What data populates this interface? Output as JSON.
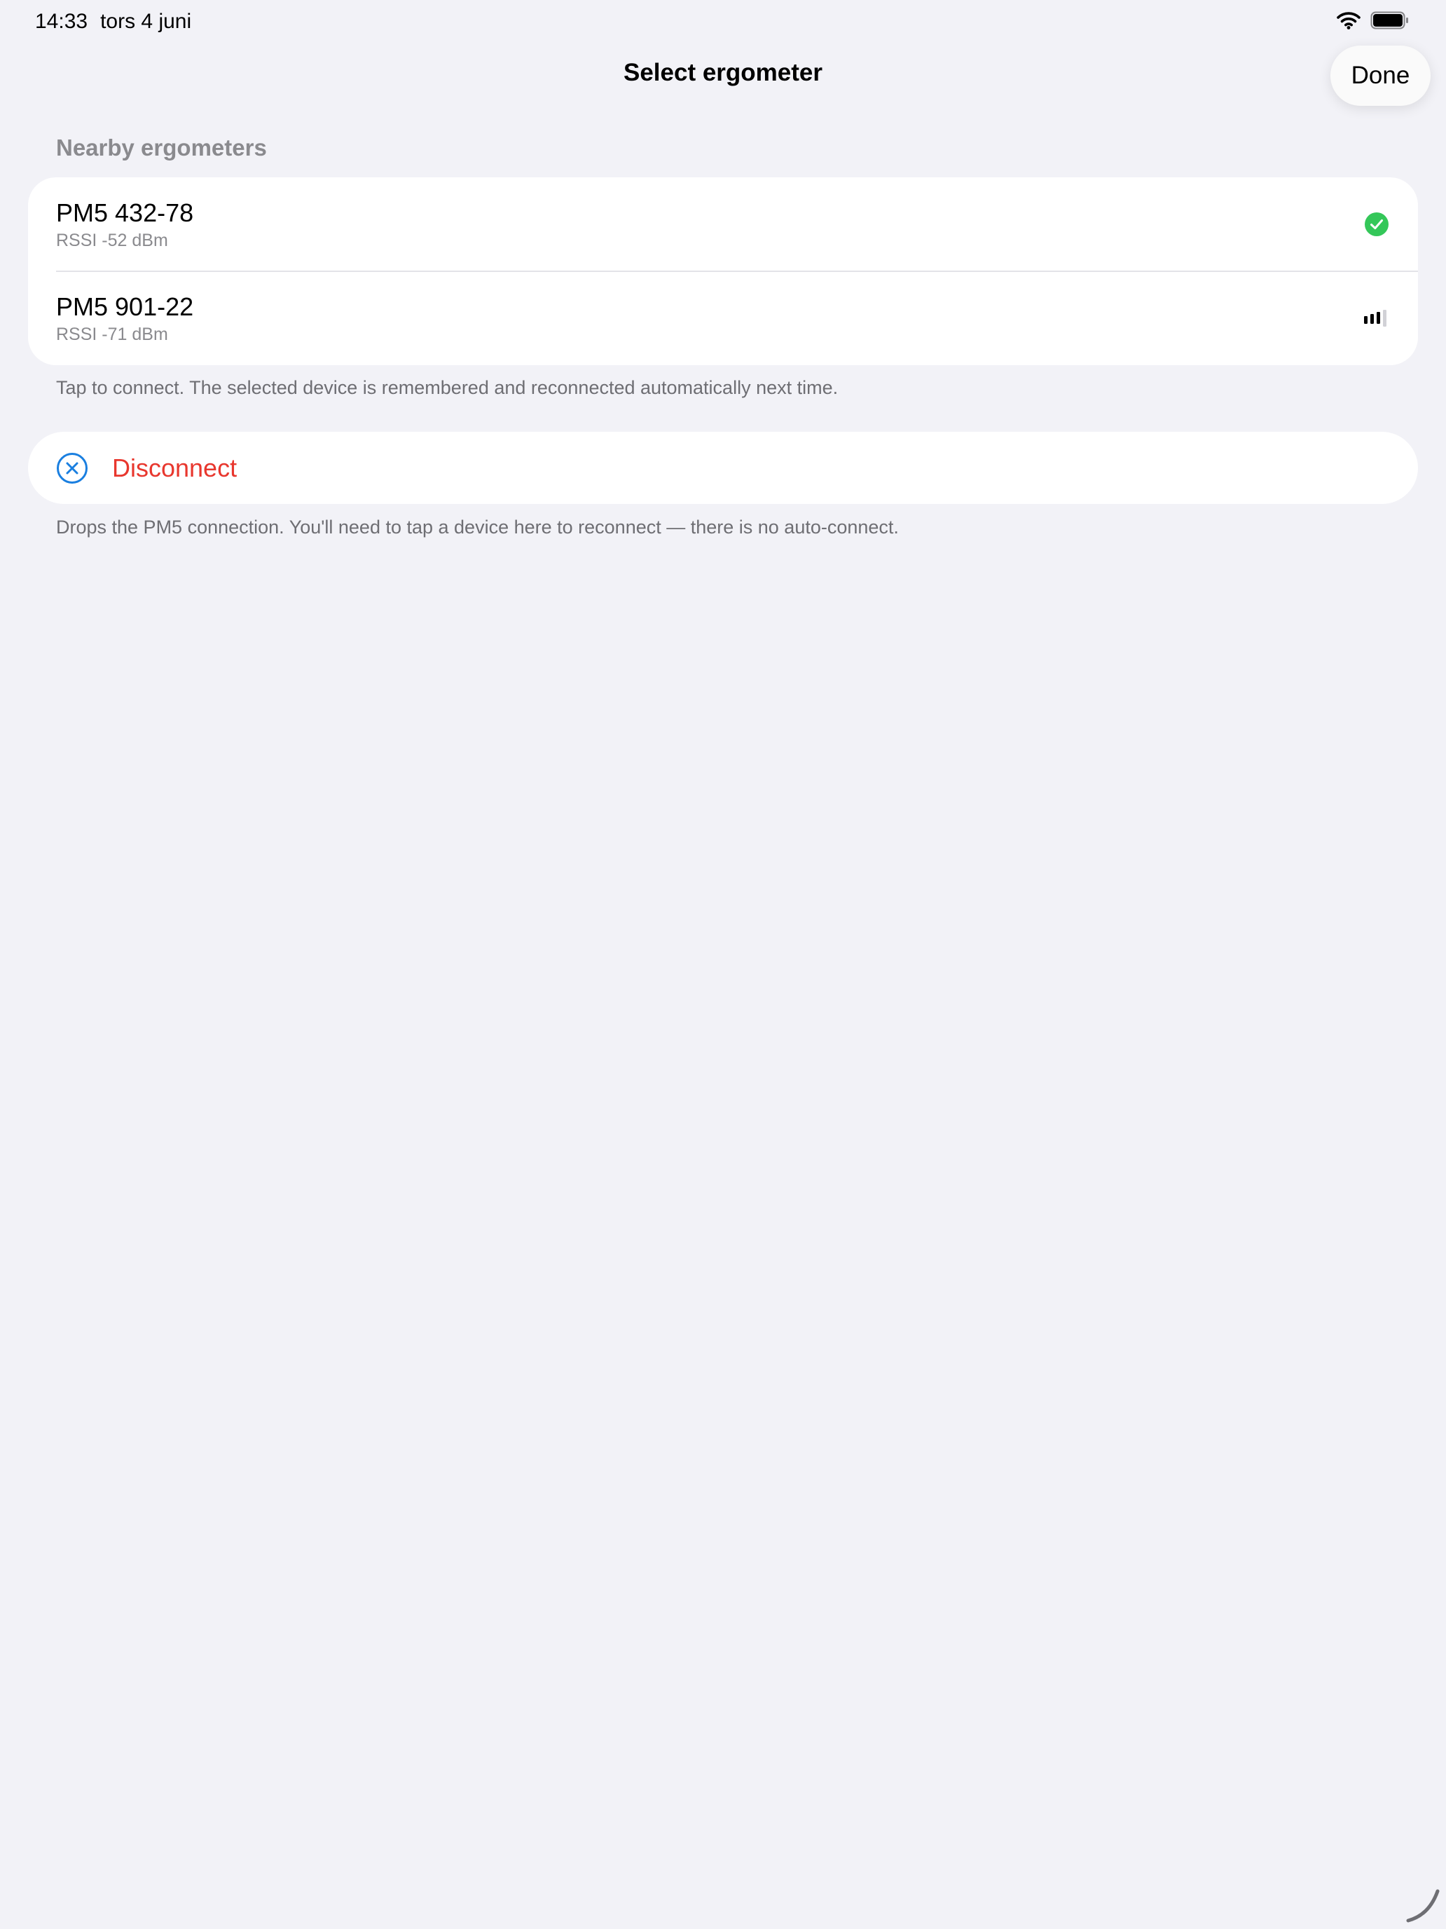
{
  "status_bar": {
    "time": "14:33",
    "date": "tors 4 juni",
    "icons": [
      "wifi-icon",
      "battery-icon"
    ]
  },
  "nav": {
    "title": "Select ergometer",
    "done_label": "Done"
  },
  "section": {
    "header": "Nearby ergometers"
  },
  "devices": [
    {
      "name": "PM5 432-78",
      "rssi": "RSSI -52 dBm",
      "status_icon": "checkmark-circle-icon",
      "connected": true
    },
    {
      "name": "PM5 901-22",
      "rssi": "RSSI -71 dBm",
      "status_icon": "signal-strength-icon",
      "signal_bars": 3,
      "signal_bars_max": 4
    }
  ],
  "notes": {
    "connect": "Tap to connect. The selected device is remembered and reconnected automatically next time.",
    "disconnect": "Drops the PM5 connection. You'll need to tap a device here to reconnect — there is no auto-connect."
  },
  "disconnect": {
    "label": "Disconnect",
    "icon": "xmark-circle-icon"
  },
  "colors": {
    "background": "#f2f2f7",
    "accent": "#1a7fe0",
    "destructive": "#e8372e",
    "success": "#34c759",
    "secondary_text": "#8a8a8e"
  }
}
